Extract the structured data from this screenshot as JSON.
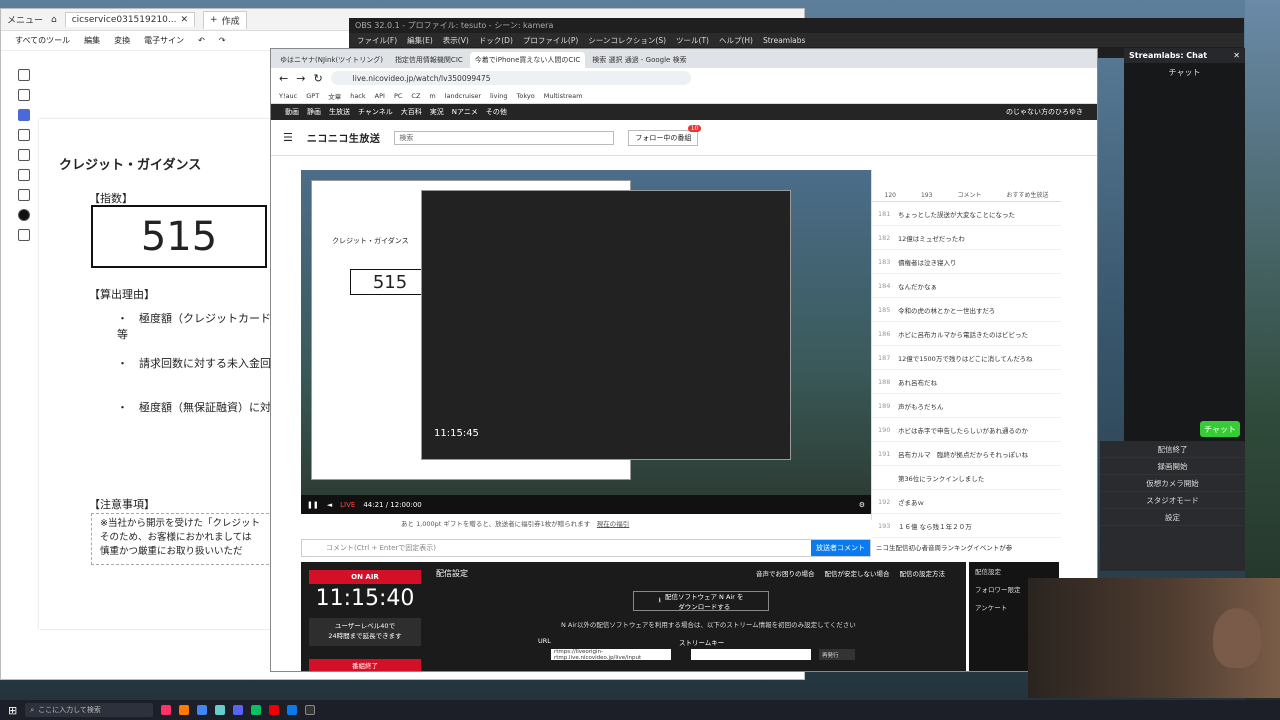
{
  "pdf": {
    "title_menu": "メニュー",
    "title_tab": "cicservice031519210...",
    "new_tab": "作成",
    "menu": [
      "すべてのツール",
      "編集",
      "変換",
      "電子サイン"
    ],
    "page": {
      "title": "クレジット・ガイダンス",
      "index_label": "【指数】",
      "index_value": "515",
      "reason_label": "【算出理由】",
      "bullets": [
        "極度額（クレジットカード等",
        "請求回数に対する未入金回",
        "極度額（無保証融資）に対"
      ],
      "notes_label": "【注意事項】",
      "note_lines": [
        "※当社から開示を受けた「クレジット",
        "そのため、お客様におかれましては",
        "慎重かつ厳重にお取り扱いいただ"
      ]
    }
  },
  "obs": {
    "title": "OBS 32.0.1 - プロファイル: tesuto - シーン: kamera",
    "menu": [
      "ファイル(F)",
      "編集(E)",
      "表示(V)",
      "ドック(D)",
      "プロファイル(P)",
      "シーンコレクション(S)",
      "ツール(T)",
      "ヘルプ(H)",
      "Streamlabs"
    ],
    "chat_header": "Streamlabs: Chat",
    "chat_title": "チャット",
    "chat_button": "チャット",
    "controls": [
      "配信終了",
      "録画開始",
      "仮想カメラ開始",
      "スタジオモード",
      "設定"
    ]
  },
  "browser": {
    "tabs": [
      "ゆはニヤナ(NJink(ツイトリング)",
      "指定信用情報機関CIC",
      "今着でiPhone買えない人間のCIC",
      "検索 選択 通過 - Google 検索"
    ],
    "url": "live.nicovideo.jp/watch/lv350099475",
    "bookmarks": [
      "Y!auc",
      "GPT",
      "文章",
      "hack",
      "API",
      "PC",
      "CZ",
      "m",
      "landcruiser",
      "living",
      "Tokyo",
      "Multistream"
    ],
    "nico_nav": [
      "動画",
      "静画",
      "生放送",
      "チャンネル",
      "大百科",
      "実況",
      "Nアニメ",
      "その他"
    ],
    "user": "のじゃない方のひろゆき",
    "logo": "ニコニコ生放送",
    "search_placeholder": "検索",
    "follow_button": "フォロー中の番組",
    "follow_count": "10"
  },
  "player": {
    "live_label": "LIVE",
    "time": "44:21 / 12:00:00",
    "inner": {
      "title": "クレジット・ガイダンス",
      "index": "515",
      "clock": "11:15:45"
    }
  },
  "comments": {
    "stats": [
      "120",
      "193"
    ],
    "tabs": [
      "コメント",
      "おすすめ生放送"
    ],
    "rows": [
      [
        "181",
        "ちょっとした誤送が大変なことになった"
      ],
      [
        "182",
        "12億はミュゼだったわ"
      ],
      [
        "183",
        "債権者は泣き寝入り"
      ],
      [
        "184",
        "なんだかなぁ"
      ],
      [
        "185",
        "令和の虎の林とかと一世出すだろ"
      ],
      [
        "186",
        "ホビに呂布カルマから電話きたのはビビった"
      ],
      [
        "187",
        "12億で1500万で残りはどこに消してんだろね"
      ],
      [
        "188",
        "あれ呂布だね"
      ],
      [
        "189",
        "声がもろだちん"
      ],
      [
        "190",
        "ホビは赤字で申告したらしいがあれ通るのか"
      ],
      [
        "191",
        "呂布カルマ　臨終が拠点だからそれっぽいね"
      ],
      [
        "",
        "第36位にランクインしました"
      ],
      [
        "192",
        "ざまあｗ"
      ],
      [
        "193",
        "１６億 なら残１年２０万"
      ]
    ]
  },
  "gift_bar": "あと 1,000pt ギフトを贈ると、放送者に福引券1枚が贈られます",
  "gift_link": "現在の福引",
  "comment_placeholder": "コメント(Ctrl + Enterで固定表示)",
  "send_button": "放送者コメント",
  "info": "ニコ生配信初心者音周ランキングイベントが参",
  "broadcast": {
    "onair": "ON AIR",
    "clock": "11:15:40",
    "user_level": "ユーザーレベル40で\n24時間まで延長できます",
    "level_link": "ユーザーレベル特典を見る",
    "end": "番組終了",
    "title": "配信設定",
    "download": "配信ソフトウェア N Air を\nダウンロードする",
    "desc": "N Air以外の配信ソフトウェアを利用する場合は、以下のストリーム情報を初回のみ設定してください",
    "url_label": "URL",
    "url_value": "rtmps://liveorigin-rtmp.live.nicovideo.jp/live/input",
    "key_label": "ストリームキー",
    "reissue": "再発行",
    "links": [
      "音声でお困りの場合",
      "配信が安定しない場合",
      "配信の設定方法"
    ],
    "side": [
      "配信設定",
      "フォロワー限定",
      "アンケート"
    ]
  },
  "taskbar": {
    "search": "ここに入力して検索"
  }
}
